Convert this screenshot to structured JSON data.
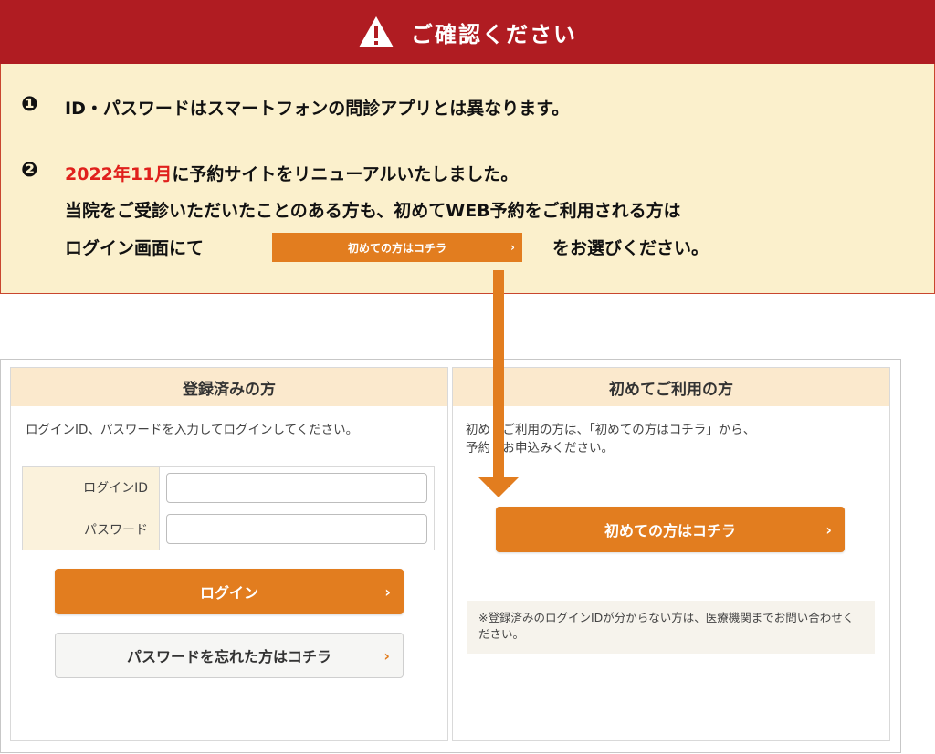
{
  "notice": {
    "title": "ご確認ください",
    "icon": "warning-triangle-icon",
    "item1_number": "❶",
    "item1_text": "ID・パスワードはスマートフォンの問診アプリとは異なります。",
    "item2_number": "❷",
    "item2_date": "2022年11月",
    "item2_text1": "に予約サイトをリニューアルいたしました。",
    "item2_text2": "当院をご受診いただいたことのある方も、初めてWEB予約をご利用される方は",
    "item2_text3_pre": "ログイン画面にて",
    "item2_button": "初めての方はコチラ",
    "item2_button_chevron": "›",
    "item2_text3_post": "をお選びください。"
  },
  "registered": {
    "heading": "登録済みの方",
    "description": "ログインID、パスワードを入力してログインしてください。",
    "login_id_label": "ログインID",
    "login_id_value": "",
    "password_label": "パスワード",
    "password_value": "",
    "login_button": "ログイン",
    "login_chevron": "›",
    "forgot_button": "パスワードを忘れた方はコチラ",
    "forgot_chevron": "›"
  },
  "first_time": {
    "heading": "初めてご利用の方",
    "description_line1": "初め　ご利用の方は、「初めての方はコチラ」から、",
    "description_line2": "予約　お申込みください。",
    "button": "初めての方はコチラ",
    "button_chevron": "›",
    "note": "※登録済みのログインIDが分からない方は、医療機関までお問い合わせください。"
  },
  "colors": {
    "banner_red": "#b01c22",
    "notice_bg": "#fbf0cc",
    "accent_orange": "#e27d1f",
    "date_red": "#e0201c",
    "panel_header_bg": "#fbe9cd"
  }
}
